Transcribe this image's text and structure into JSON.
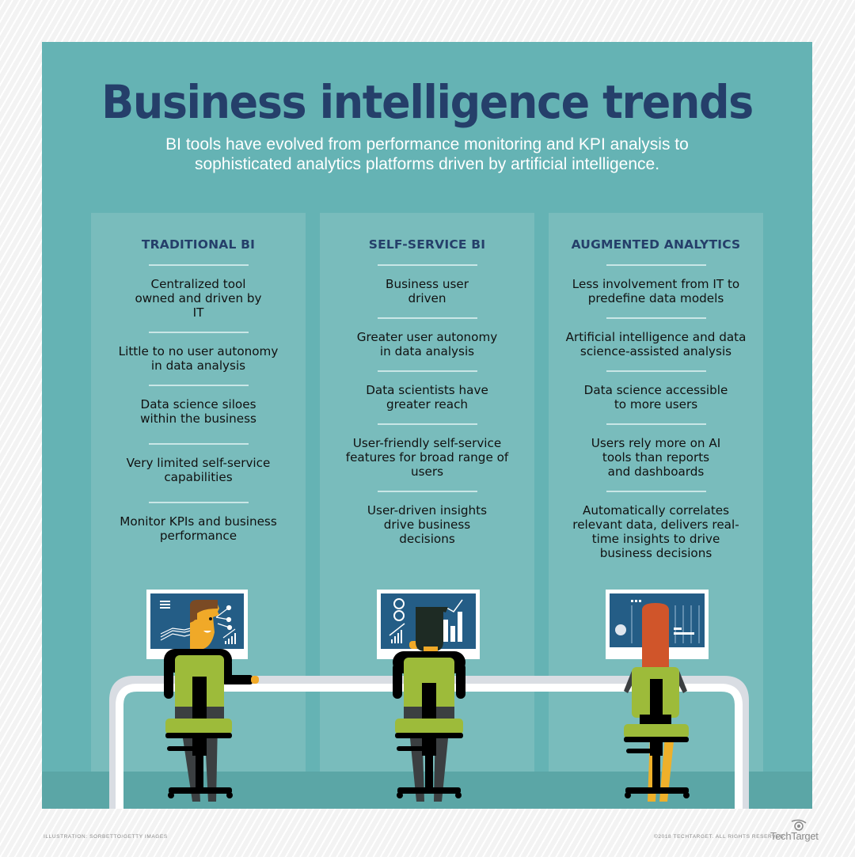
{
  "header": {
    "title": "Business intelligence trends",
    "subtitle_lines": [
      "BI tools have evolved from performance monitoring and KPI analysis to",
      "sophisticated analytics platforms driven by artificial intelligence."
    ]
  },
  "columns": [
    {
      "heading": "TRADITIONAL BI",
      "items": [
        "Centralized tool owned and driven by IT",
        "Little to no user autonomy in data analysis",
        "Data science siloes within the business",
        "Very limited self-service capabilities",
        "Monitor KPIs and business performance"
      ]
    },
    {
      "heading": "SELF-SERVICE BI",
      "items": [
        "Business user driven",
        "Greater user autonomy in data analysis",
        "Data scientists have greater reach",
        "User-friendly self-service features for broad range of users",
        "User-driven insights drive business decisions"
      ]
    },
    {
      "heading": "AUGMENTED ANALYTICS",
      "items": [
        "Less involvement from IT to predefine data models",
        "Artificial intelligence and data science-assisted analysis",
        "Data science accessible to more users",
        "Users rely more on AI tools than reports and dashboards",
        "Automatically correlates relevant data, delivers real-time insights to drive business decisions"
      ]
    }
  ],
  "illustration": {
    "figures": [
      "man-at-bi-dashboard",
      "person-at-self-service-dashboard",
      "woman-at-augmented-dashboard"
    ]
  },
  "footer": {
    "credit": "ILLUSTRATION: SORBETTO/GETTY IMAGES",
    "copyright": "©2018 TECHTARGET. ALL RIGHTS RESERVED",
    "brand": "TechTarget"
  },
  "colors": {
    "panel": "#65b3b4",
    "column": "#79bcbc",
    "title": "#253f6a",
    "floor": "#5ba6a6",
    "screen": "#245d86",
    "shirt": "#9dbb3a",
    "skin": "#f0a928",
    "hair_man": "#7a4a24",
    "hair_woman": "#d0552a"
  }
}
